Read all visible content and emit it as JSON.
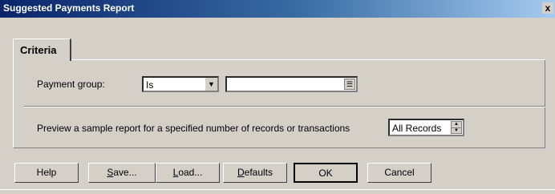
{
  "window": {
    "title": "Suggested Payments Report",
    "close_glyph": "x"
  },
  "tabs": [
    {
      "label": "Criteria",
      "selected": true
    }
  ],
  "criteria": {
    "payment_group_label": "Payment group:",
    "operator": {
      "value": "Is"
    },
    "payment_group_value": {
      "value": ""
    },
    "preview_label": "Preview a sample report for a specified number of records or transactions",
    "preview_count": {
      "value": "All Records"
    }
  },
  "buttons": {
    "help": {
      "label": "Help"
    },
    "save": {
      "label_prefix": "S",
      "label_rest": "ave..."
    },
    "load": {
      "label_prefix": "L",
      "label_rest": "oad..."
    },
    "defaults": {
      "label_prefix": "D",
      "label_rest": "efaults"
    },
    "ok": {
      "label": "OK"
    },
    "cancel": {
      "label": "Cancel"
    }
  }
}
